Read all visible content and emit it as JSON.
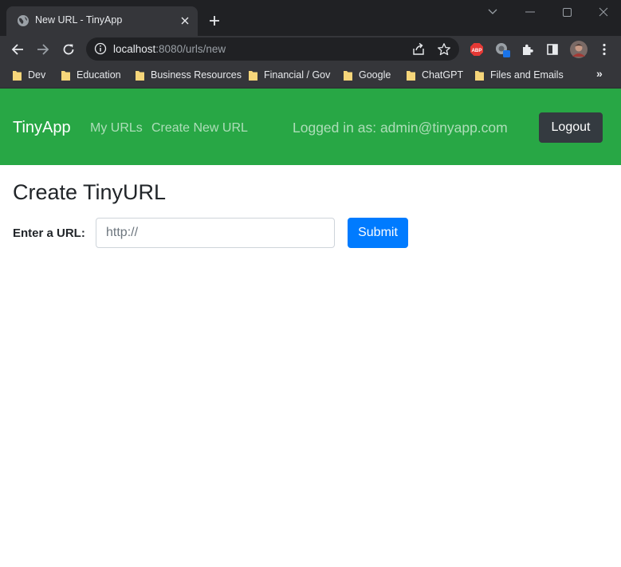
{
  "browser": {
    "tab_title": "New URL - TinyApp",
    "url_host": "localhost",
    "url_path": ":8080/urls/new",
    "bookmarks": [
      {
        "label": "Dev"
      },
      {
        "label": "Education"
      },
      {
        "label": "Business Resources"
      },
      {
        "label": "Financial / Gov"
      },
      {
        "label": "Google"
      },
      {
        "label": "ChatGPT"
      },
      {
        "label": "Files and Emails"
      }
    ],
    "more_bookmarks": "»",
    "extension_abp": "ABP",
    "colors": {
      "frame": "#202124",
      "toolbar": "#35363a",
      "folder": "#f6d67a"
    },
    "icons": [
      "globe-icon",
      "close-icon",
      "plus-icon",
      "minimize-icon",
      "maximize-icon",
      "window-close-icon",
      "back-icon",
      "forward-icon",
      "reload-icon",
      "info-icon",
      "share-icon",
      "star-icon",
      "abp-icon",
      "extension-icon",
      "puzzle-icon",
      "sidepanel-icon",
      "profile-avatar",
      "kebab-menu-icon",
      "folder-icon"
    ]
  },
  "navbar": {
    "brand": "TinyApp",
    "links": [
      "My URLs",
      "Create New URL"
    ],
    "logged_in_text": "Logged in as: admin@tinyapp.com",
    "logout_label": "Logout",
    "colors": {
      "background": "#28a745",
      "logout": "#343a40"
    }
  },
  "main": {
    "title": "Create TinyURL",
    "url_label": "Enter a URL:",
    "url_placeholder": "http://",
    "url_value": "",
    "submit_label": "Submit",
    "colors": {
      "submit": "#007bff"
    }
  }
}
